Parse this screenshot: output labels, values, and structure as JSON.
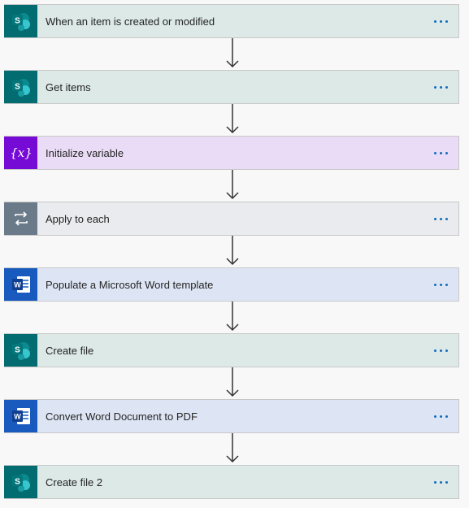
{
  "steps": [
    {
      "title": "When an item is created or modified",
      "type": "sharepoint",
      "icon": "sharepoint-icon"
    },
    {
      "title": "Get items",
      "type": "sharepoint",
      "icon": "sharepoint-icon"
    },
    {
      "title": "Initialize variable",
      "type": "variable",
      "icon": "variable-icon"
    },
    {
      "title": "Apply to each",
      "type": "loop",
      "icon": "loop-icon"
    },
    {
      "title": "Populate a Microsoft Word template",
      "type": "word",
      "icon": "word-icon"
    },
    {
      "title": "Create file",
      "type": "sharepoint",
      "icon": "sharepoint-icon"
    },
    {
      "title": "Convert Word Document to PDF",
      "type": "word",
      "icon": "word-icon"
    },
    {
      "title": "Create file 2",
      "type": "sharepoint",
      "icon": "sharepoint-icon"
    }
  ],
  "colors": {
    "sharepoint": "#036c70",
    "variable": "#770bd6",
    "loop": "#6b7a89",
    "word": "#185abd",
    "more_button": "#0f6cbd"
  }
}
